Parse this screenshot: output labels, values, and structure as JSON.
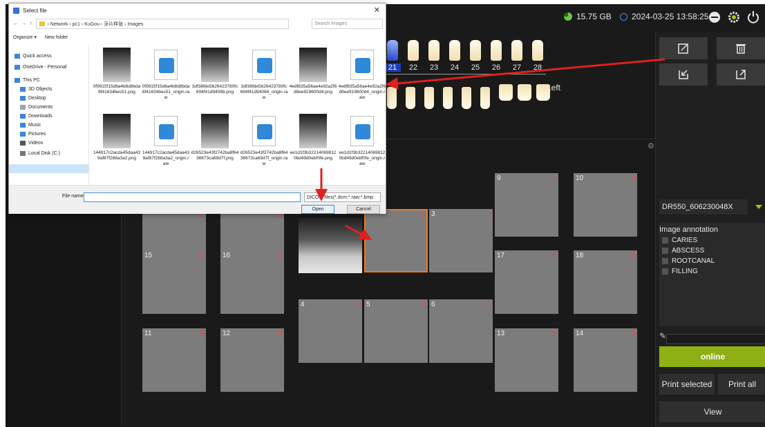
{
  "status": {
    "disk": "15.75 GB",
    "datetime": "2024-03-25 13:58:25"
  },
  "teeth": {
    "numbers": [
      "21",
      "22",
      "23",
      "24",
      "25",
      "26",
      "27",
      "28"
    ],
    "selected": "21",
    "side_label": "Left"
  },
  "slots": [
    {
      "num": "9",
      "count": "0"
    },
    {
      "num": "10",
      "count": "0"
    },
    {
      "num": "",
      "count": "0"
    },
    {
      "num": "",
      "count": "0"
    },
    {
      "num": "",
      "count": ""
    },
    {
      "num": "",
      "count": "0"
    },
    {
      "num": "3",
      "count": "0"
    },
    {
      "num": "15",
      "count": "0"
    },
    {
      "num": "16",
      "count": "0"
    },
    {
      "num": "17",
      "count": "0"
    },
    {
      "num": "18",
      "count": "0"
    },
    {
      "num": "4",
      "count": "0"
    },
    {
      "num": "5",
      "count": "0"
    },
    {
      "num": "6",
      "count": "0"
    },
    {
      "num": "11",
      "count": "0"
    },
    {
      "num": "12",
      "count": "0"
    },
    {
      "num": "13",
      "count": "0"
    },
    {
      "num": "14",
      "count": "0"
    }
  ],
  "right_panel": {
    "device": "DR550_606230048X",
    "annotation_title": "Image annotation",
    "annotations": [
      "CARIES",
      "ABSCESS",
      "ROOTCANAL",
      "FILLING"
    ],
    "online_label": "online",
    "print_selected_label": "Print selected",
    "print_all_label": "Print all",
    "view_label": "View"
  },
  "dialog": {
    "title": "Select file",
    "path": [
      "Network",
      "pc1",
      "KuGou",
      "牙片样张",
      "Images"
    ],
    "search_placeholder": "Search Images",
    "organize_label": "Organize ▾",
    "new_folder_label": "New folder",
    "nav": [
      "Quick access",
      "OneDrive - Personal",
      "This PC",
      "3D Objects",
      "Desktop",
      "Documents",
      "Downloads",
      "Music",
      "Pictures",
      "Videos",
      "Local Disk (C:)",
      "Network"
    ],
    "files": [
      {
        "name": "0f9915f15d6a4b8d8bda6f41634bec51.png",
        "kind": "xray"
      },
      {
        "name": "0f9915f15d6a4b8d8bda6f41634bec51_origin.raw",
        "kind": "doc"
      },
      {
        "name": "3df38fde5626423780fc694f41d94088.png",
        "kind": "xray"
      },
      {
        "name": "3df38fde5626423780fc694f41d94088_origin.raw",
        "kind": "doc"
      },
      {
        "name": "4edf835a56ae4e92a2f6d8ee919600d4.png",
        "kind": "xray"
      },
      {
        "name": "4edf835a56ae4e92a2f6d8ee919600d4_origin.raw",
        "kind": "doc"
      },
      {
        "name": "144917c2acda45daa439af87f268a3a2.png",
        "kind": "xray"
      },
      {
        "name": "144917c2acda45daa439af87f268a3a2_origin.raw",
        "kind": "doc"
      },
      {
        "name": "d26523e43f2742ba8f6436673ca69d7f.png",
        "kind": "xray"
      },
      {
        "name": "d26523e43f2742ba8f6436673ca69d7f_origin.raw",
        "kind": "doc"
      },
      {
        "name": "ee1d1f3b322140698120bd49d0ebf0fe.png",
        "kind": "xray"
      },
      {
        "name": "ee1d1f3b322140698120bd49d0ebf0fe_origin.raw",
        "kind": "doc"
      }
    ],
    "filename_label": "File name:",
    "filename_value": "",
    "filetype": "DICOM files(*.dcm;*.raw;*.bmp",
    "open_label": "Open",
    "cancel_label": "Cancel"
  }
}
